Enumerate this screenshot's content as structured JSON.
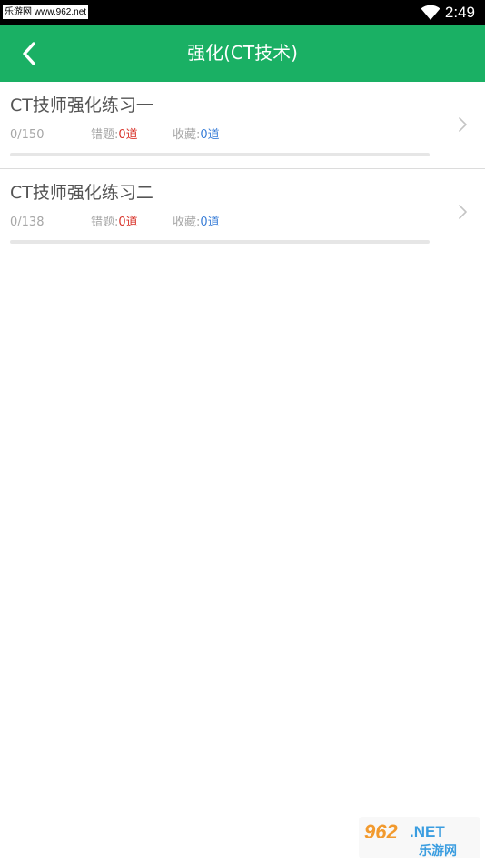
{
  "status_bar": {
    "watermark": "乐游网 www.962.net",
    "time": "2:49",
    "icons": [
      "wifi-icon",
      "battery-icon"
    ]
  },
  "header": {
    "title": "强化(CT技术)",
    "back_icon": "chevron-left-icon",
    "background": "#1ab064"
  },
  "exercises": [
    {
      "title": "CT技师强化练习一",
      "progress_text": "0/150",
      "progress_fraction": 0,
      "wrong_label": "错题:",
      "wrong_count": "0道",
      "fav_label": "收藏:",
      "fav_count": "0道"
    },
    {
      "title": "CT技师强化练习二",
      "progress_text": "0/138",
      "progress_fraction": 0,
      "wrong_label": "错题:",
      "wrong_count": "0道",
      "fav_label": "收藏:",
      "fav_count": "0道"
    }
  ],
  "colors": {
    "accent": "#1ab064",
    "wrong": "#d9342b",
    "favorite": "#3b7fd8"
  },
  "watermark_logo": {
    "text": "962.NET 乐游网"
  }
}
